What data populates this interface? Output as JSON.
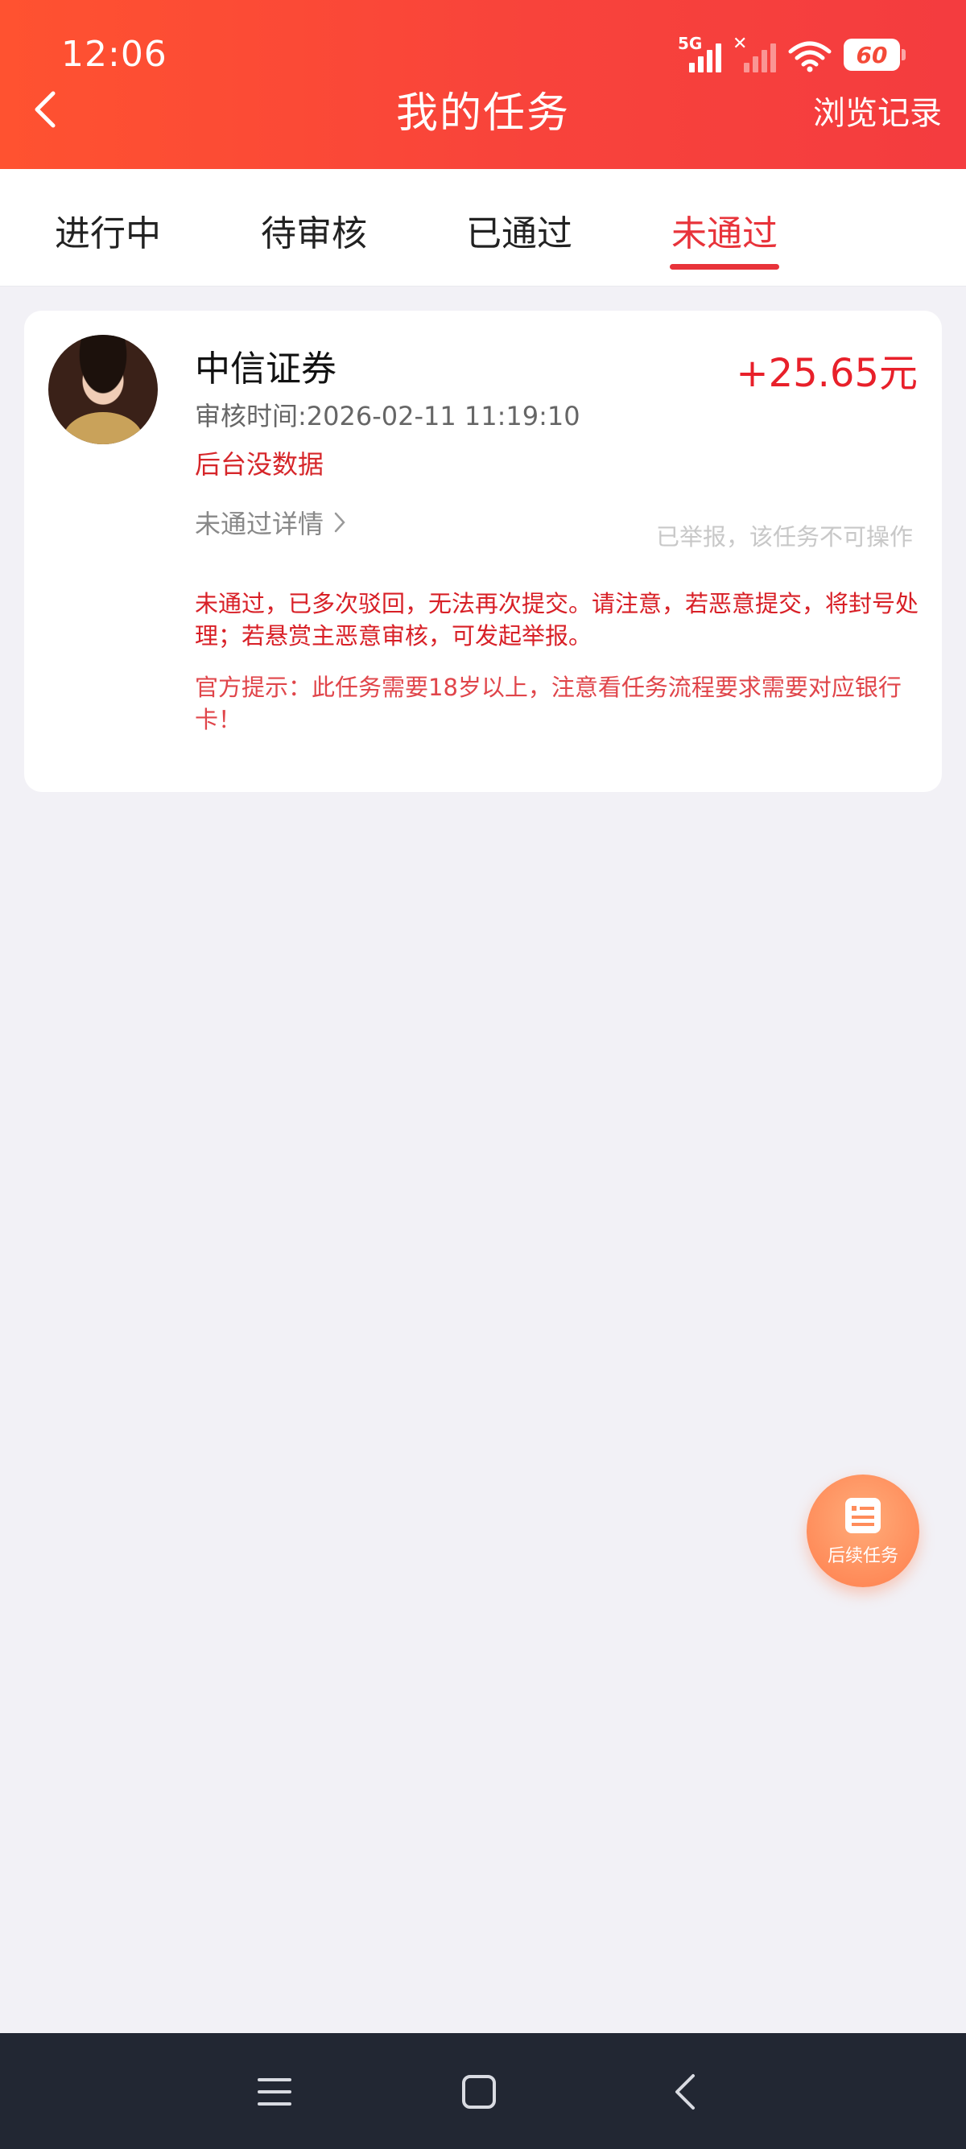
{
  "status_bar": {
    "time": "12:06",
    "network_tag": "5G",
    "battery": "60"
  },
  "header": {
    "title": "我的任务",
    "history_label": "浏览记录"
  },
  "tabs": [
    {
      "label": "进行中",
      "active": false
    },
    {
      "label": "待审核",
      "active": false
    },
    {
      "label": "已通过",
      "active": false
    },
    {
      "label": "未通过",
      "active": true
    }
  ],
  "task": {
    "name": "中信证券",
    "reward": "+25.65元",
    "review_time": "审核时间:2026-02-11 11:19:10",
    "reason": "后台没数据",
    "detail_link": "未通过详情",
    "reported_note": "已举报，该任务不可操作",
    "warning": "未通过，已多次驳回，无法再次提交。请注意，若恶意提交，将封号处理；若悬赏主恶意审核，可发起举报。",
    "official_tip": "官方提示：此任务需要18岁以上，注意看任务流程要求需要对应银行卡！"
  },
  "float_button": {
    "label": "后续任务",
    "icon": "task-list-icon"
  },
  "colors": {
    "header_start": "#ff5230",
    "header_end": "#f43c3f",
    "accent_red": "#e8333a",
    "page_bg": "#f2f1f6",
    "navbar_bg": "#222733"
  }
}
